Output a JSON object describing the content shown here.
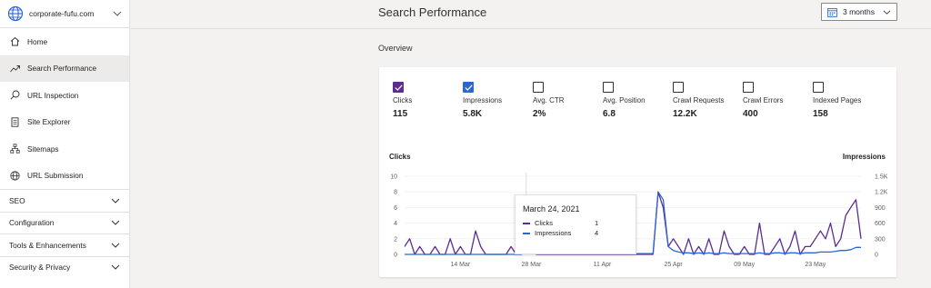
{
  "sidebar": {
    "site": "corporate-fufu.com",
    "items": [
      {
        "label": "Home",
        "icon": "home-icon"
      },
      {
        "label": "Search Performance",
        "icon": "trend-icon",
        "active": true
      },
      {
        "label": "URL Inspection",
        "icon": "search-icon"
      },
      {
        "label": "Site Explorer",
        "icon": "document-icon"
      },
      {
        "label": "Sitemaps",
        "icon": "sitemap-icon"
      },
      {
        "label": "URL Submission",
        "icon": "globe-icon"
      }
    ],
    "sections": [
      "SEO",
      "Configuration",
      "Tools & Enhancements",
      "Security & Privacy"
    ]
  },
  "header": {
    "title": "Search Performance",
    "range_label": "3 months"
  },
  "overview": {
    "title": "Overview",
    "metrics": [
      {
        "label": "Clicks",
        "value": "115",
        "checked": true
      },
      {
        "label": "Impressions",
        "value": "5.8K",
        "checked": true
      },
      {
        "label": "Avg. CTR",
        "value": "2%",
        "checked": false
      },
      {
        "label": "Avg. Position",
        "value": "6.8",
        "checked": false
      },
      {
        "label": "Crawl Requests",
        "value": "12.2K",
        "checked": false
      },
      {
        "label": "Crawl Errors",
        "value": "400",
        "checked": false
      },
      {
        "label": "Indexed Pages",
        "value": "158",
        "checked": false
      }
    ]
  },
  "tooltip": {
    "date": "March 24, 2021",
    "rows": [
      {
        "name": "Clicks",
        "value": "1"
      },
      {
        "name": "Impressions",
        "value": "4"
      }
    ]
  },
  "colors": {
    "clicks": "#5c2d91",
    "impressions": "#2b66d9"
  },
  "chart_data": {
    "type": "line",
    "left_axis_label": "Clicks",
    "right_axis_label": "Impressions",
    "left_ylim": [
      0,
      10
    ],
    "right_ylim": [
      0,
      1500
    ],
    "left_ticks": [
      "0",
      "2",
      "4",
      "6",
      "8",
      "10"
    ],
    "right_ticks": [
      "0",
      "300",
      "600",
      "900",
      "1.2K",
      "1.5K"
    ],
    "x_ticks": [
      "14 Mar",
      "28 Mar",
      "11 Apr",
      "25 Apr",
      "09 May",
      "23 May"
    ],
    "x_tick_index": [
      11,
      25,
      39,
      53,
      67,
      81
    ],
    "series": [
      {
        "name": "Clicks",
        "axis": "left",
        "values": [
          1,
          2,
          0,
          1,
          0,
          0,
          1,
          0,
          0,
          2,
          0,
          1,
          0,
          0,
          3,
          1,
          0,
          0,
          0,
          0,
          0,
          1,
          0,
          1,
          1,
          1,
          0,
          0,
          0,
          0,
          0,
          0,
          0,
          0,
          0,
          0,
          0,
          0,
          0,
          0,
          0,
          0,
          0,
          0,
          0,
          0,
          0,
          0,
          0,
          0,
          8,
          6,
          1,
          2,
          1,
          0,
          2,
          0,
          1,
          0,
          2,
          0,
          0,
          3,
          1,
          0,
          0,
          1,
          0,
          0,
          4,
          0,
          0,
          1,
          2,
          0,
          1,
          3,
          0,
          1,
          1,
          2,
          3,
          2,
          4,
          1,
          2,
          5,
          6,
          7,
          2
        ]
      },
      {
        "name": "Impressions",
        "axis": "left",
        "values": [
          0,
          0,
          0,
          0,
          0,
          0,
          0,
          0,
          0,
          0,
          0,
          0,
          0,
          0,
          0,
          0,
          0,
          0,
          0,
          0,
          0,
          0,
          0,
          0,
          0.3,
          0.1,
          0.1,
          0.1,
          0.1,
          0.1,
          0.1,
          0.1,
          0.1,
          0.1,
          0.1,
          0.1,
          0.1,
          0.1,
          0.1,
          0.1,
          0.1,
          0.1,
          0.1,
          0.1,
          0.1,
          0.1,
          0.1,
          0.1,
          0.1,
          0.1,
          8,
          7,
          1,
          0.5,
          0.3,
          0.2,
          0.2,
          0.1,
          0.2,
          0.1,
          0.2,
          0.1,
          0.1,
          0.2,
          0.1,
          0.1,
          0.1,
          0.1,
          0.1,
          0.1,
          0.2,
          0.1,
          0.1,
          0.2,
          0.2,
          0.1,
          0.2,
          0.2,
          0.1,
          0.2,
          0.2,
          0.2,
          0.3,
          0.3,
          0.3,
          0.4,
          0.5,
          0.5,
          0.6,
          0.9,
          0.9
        ]
      }
    ]
  }
}
